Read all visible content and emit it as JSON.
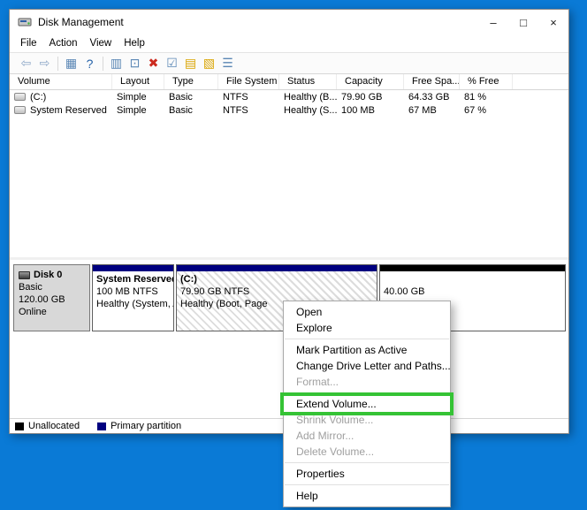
{
  "window": {
    "title": "Disk Management",
    "caption": {
      "minimize": "–",
      "maximize": "□",
      "close": "×"
    }
  },
  "menubar": {
    "items": [
      "File",
      "Action",
      "View",
      "Help"
    ]
  },
  "toolbar": {
    "icons": [
      {
        "name": "back-icon",
        "glyph": "⇦",
        "color": "#8ea8c8"
      },
      {
        "name": "forward-icon",
        "glyph": "⇨",
        "color": "#8ea8c8"
      },
      {
        "name": "toolbar-separator",
        "separator": true
      },
      {
        "name": "show-console-tree-icon",
        "glyph": "▦",
        "color": "#5b87b5"
      },
      {
        "name": "help-icon",
        "glyph": "?",
        "color": "#2461a8"
      },
      {
        "name": "toolbar-separator",
        "separator": true
      },
      {
        "name": "action-pane-icon",
        "glyph": "▥",
        "color": "#5b87b5"
      },
      {
        "name": "refresh-icon",
        "glyph": "⊡",
        "color": "#5b87b5"
      },
      {
        "name": "delete-volume-icon",
        "glyph": "✖",
        "color": "#cc2a1e"
      },
      {
        "name": "mark-active-icon",
        "glyph": "☑",
        "color": "#5b87b5"
      },
      {
        "name": "open-volume-icon",
        "glyph": "▤",
        "color": "#d9a400"
      },
      {
        "name": "format-volume-icon",
        "glyph": "▧",
        "color": "#d9a400"
      },
      {
        "name": "list-view-icon",
        "glyph": "☰",
        "color": "#5b87b5"
      }
    ]
  },
  "volume_table": {
    "columns": [
      "Volume",
      "Layout",
      "Type",
      "File System",
      "Status",
      "Capacity",
      "Free Spa...",
      "% Free"
    ],
    "rows": [
      {
        "cells": [
          "(C:)",
          "Simple",
          "Basic",
          "NTFS",
          "Healthy (B...",
          "79.90 GB",
          "64.33 GB",
          "81 %"
        ]
      },
      {
        "cells": [
          "System Reserved",
          "Simple",
          "Basic",
          "NTFS",
          "Healthy (S...",
          "100 MB",
          "67 MB",
          "67 %"
        ]
      }
    ]
  },
  "disk_view": {
    "disk": {
      "name": "Disk 0",
      "type": "Basic",
      "size": "120.00 GB",
      "status": "Online"
    },
    "partitions": [
      {
        "id": "system-reserved",
        "title": "System Reserved",
        "line2": "100 MB NTFS",
        "line3": "Healthy (System, A",
        "stripe": "#000080",
        "hatched": false
      },
      {
        "id": "c-drive",
        "title": "(C:)",
        "line2": "79.90 GB NTFS",
        "line3": "Healthy (Boot, Page",
        "stripe": "#000080",
        "hatched": true
      },
      {
        "id": "unallocated",
        "title": "",
        "line2": "40.00 GB",
        "line3": "",
        "stripe": "#000000",
        "hatched": false
      }
    ]
  },
  "legend": {
    "items": [
      {
        "label": "Unallocated",
        "color": "#000000"
      },
      {
        "label": "Primary partition",
        "color": "#000080"
      }
    ]
  },
  "context_menu": {
    "highlight_color": "#35c335",
    "items": [
      {
        "label": "Open",
        "enabled": true
      },
      {
        "label": "Explore",
        "enabled": true
      },
      {
        "separator": true
      },
      {
        "label": "Mark Partition as Active",
        "enabled": true
      },
      {
        "label": "Change Drive Letter and Paths...",
        "enabled": true
      },
      {
        "label": "Format...",
        "enabled": false
      },
      {
        "separator": true
      },
      {
        "label": "Extend Volume...",
        "enabled": true,
        "highlighted": true
      },
      {
        "label": "Shrink Volume...",
        "enabled": false
      },
      {
        "label": "Add Mirror...",
        "enabled": false
      },
      {
        "label": "Delete Volume...",
        "enabled": false
      },
      {
        "separator": true
      },
      {
        "label": "Properties",
        "enabled": true
      },
      {
        "separator": true
      },
      {
        "label": "Help",
        "enabled": true
      }
    ]
  }
}
